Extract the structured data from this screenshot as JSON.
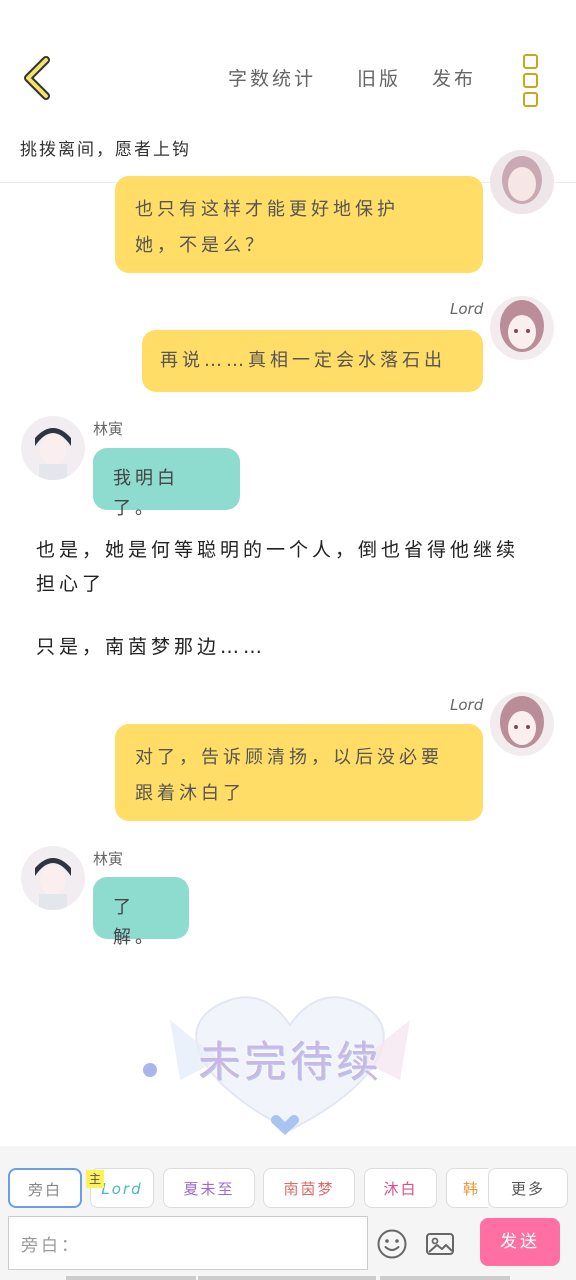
{
  "header": {
    "nav": [
      "字数统计",
      "旧版",
      "发布"
    ],
    "title": "挑拨离间，愿者上钩"
  },
  "messages": {
    "m1": {
      "text_line1": "也只有这样才能更好地保护",
      "text_line2": "她，不是么？"
    },
    "m2": {
      "speaker": "Lord",
      "text": "再说……真相一定会水落石出"
    },
    "m3": {
      "speaker": "林寅",
      "text": "我明白了。"
    },
    "narration1": {
      "line1": "也是，她是何等聪明的一个人，倒也省得他继续",
      "line2": "担心了"
    },
    "narration2": "只是，南茵梦那边……",
    "m4": {
      "speaker": "Lord",
      "text_line1": "对了，告诉顾清扬，以后没必要",
      "text_line2": "跟着沐白了"
    },
    "m5": {
      "speaker": "林寅",
      "text": "了解。"
    }
  },
  "watermark": {
    "text": "未完待续"
  },
  "characters": {
    "items": [
      {
        "label": "旁白",
        "color": "#888888"
      },
      {
        "label": "Lord",
        "color": "#4ab7c9",
        "badge": "主"
      },
      {
        "label": "夏未至",
        "color": "#9b6bd1"
      },
      {
        "label": "南茵梦",
        "color": "#e06a6a"
      },
      {
        "label": "沐白",
        "color": "#e04d8c"
      },
      {
        "label": "韩",
        "color": "#e89a3a"
      }
    ],
    "more": "更多"
  },
  "input": {
    "placeholder": "旁白："
  },
  "send_label": "发送",
  "colors": {
    "accent_yellow": "#ffdd66",
    "accent_teal": "#8edbd0",
    "send_pink": "#ff6fa2",
    "icon_gold": "#c9a71c"
  }
}
